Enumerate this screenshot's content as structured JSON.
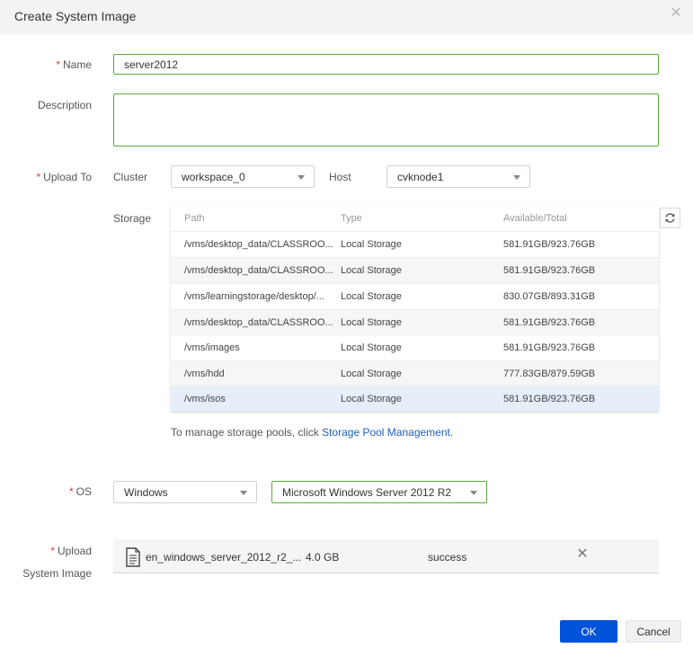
{
  "dialog": {
    "title": "Create System Image",
    "close_icon": "close-icon"
  },
  "form": {
    "required_mark": "*",
    "name_label": "Name",
    "name_value": "server2012",
    "description_label": "Description",
    "description_value": "",
    "upload_to_label": "Upload To",
    "cluster_label": "Cluster",
    "cluster_value": "workspace_0",
    "host_label": "Host",
    "host_value": "cvknode1",
    "storage_label": "Storage",
    "os_label": "OS",
    "os_type_value": "Windows",
    "os_version_value": "Microsoft Windows Server 2012 R2",
    "upload_label_line1": "Upload",
    "upload_label_line2": "System Image"
  },
  "storage_table": {
    "columns": [
      "Path",
      "Type",
      "Available/Total"
    ],
    "rows": [
      {
        "path": "/vms/desktop_data/CLASSROO...",
        "type": "Local Storage",
        "capacity": "581.91GB/923.76GB"
      },
      {
        "path": "/vms/desktop_data/CLASSROO...",
        "type": "Local Storage",
        "capacity": "581.91GB/923.76GB"
      },
      {
        "path": "/vms/learningstorage/desktop/...",
        "type": "Local Storage",
        "capacity": "830.07GB/893.31GB"
      },
      {
        "path": "/vms/desktop_data/CLASSROO...",
        "type": "Local Storage",
        "capacity": "581.91GB/923.76GB"
      },
      {
        "path": "/vms/images",
        "type": "Local Storage",
        "capacity": "581.91GB/923.76GB"
      },
      {
        "path": "/vms/hdd",
        "type": "Local Storage",
        "capacity": "777.83GB/879.59GB"
      },
      {
        "path": "/vms/isos",
        "type": "Local Storage",
        "capacity": "581.91GB/923.76GB"
      }
    ],
    "selected_row": 6,
    "refresh_icon": "refresh-icon"
  },
  "hint": {
    "prefix": "To manage storage pools, click ",
    "link": "Storage Pool Management",
    "suffix": "."
  },
  "upload": {
    "file_icon": "file-icon",
    "file_name": "en_windows_server_2012_r2_...",
    "file_size": "4.0 GB",
    "status": "success",
    "remove_icon": "remove-icon"
  },
  "footer": {
    "ok_label": "OK",
    "cancel_label": "Cancel"
  },
  "colors": {
    "primary": "#0052d9",
    "field_border_active": "#5aaa3a",
    "required": "#e23a3a",
    "link": "#1f5fb8",
    "selected_row": "#e6eef9"
  }
}
